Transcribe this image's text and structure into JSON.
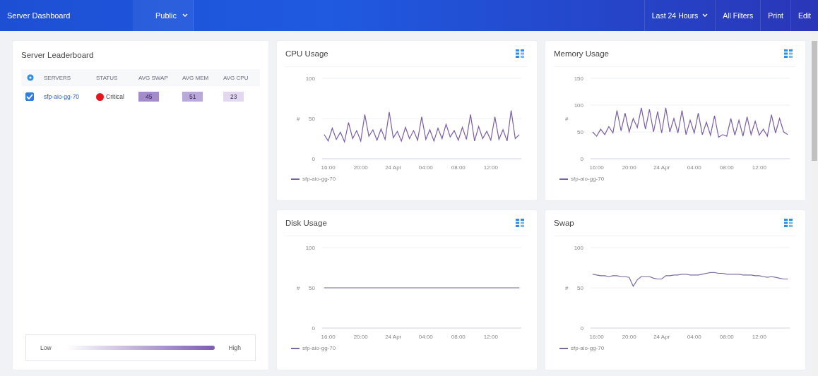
{
  "topbar": {
    "title": "Server Dashboard",
    "view": {
      "label": "Public",
      "dropdown": true
    },
    "actions": [
      {
        "label": "Last 24 Hours",
        "dropdown": true
      },
      {
        "label": "All Filters",
        "dropdown": false
      },
      {
        "label": "Print",
        "dropdown": false
      },
      {
        "label": "Edit",
        "dropdown": false
      }
    ]
  },
  "leaderboard": {
    "title": "Server Leaderboard",
    "columns": [
      "SERVERS",
      "STATUS",
      "AVG SWAP",
      "AVG MEM",
      "AVG CPU"
    ],
    "rows": [
      {
        "checked": true,
        "server": "sfp-aio-gg-70",
        "status": {
          "label": "Critical",
          "color": "#e8141b"
        },
        "metrics": [
          {
            "value": "45",
            "color": "#a48bcc"
          },
          {
            "value": "51",
            "color": "#bba8db"
          },
          {
            "value": "23",
            "color": "#e2d9f0"
          }
        ]
      }
    ],
    "legend": {
      "low": "Low",
      "high": "High"
    }
  },
  "charts": [
    {
      "title": "CPU Usage",
      "chart_data": {
        "type": "line",
        "ylabel": "#",
        "ylim": [
          0,
          100
        ],
        "yticks": [
          0,
          50,
          100
        ],
        "categories": [
          null,
          "16:00",
          null,
          null,
          null,
          null,
          null,
          null,
          null,
          "20:00",
          null,
          null,
          null,
          null,
          null,
          null,
          null,
          "24 Apr",
          null,
          null,
          null,
          null,
          null,
          null,
          null,
          "04:00",
          null,
          null,
          null,
          null,
          null,
          null,
          null,
          "08:00",
          null,
          null,
          null,
          null,
          null,
          null,
          null,
          "12:00",
          null,
          null,
          null,
          null,
          null,
          null,
          null
        ],
        "series": [
          {
            "name": "sfp-aio-gg-70",
            "color": "#7b5ea7",
            "values": [
              30,
              22,
              38,
              24,
              33,
              21,
              45,
              25,
              35,
              22,
              55,
              28,
              36,
              23,
              37,
              24,
              58,
              26,
              34,
              22,
              39,
              25,
              35,
              23,
              52,
              24,
              36,
              22,
              38,
              25,
              43,
              27,
              35,
              23,
              39,
              24,
              55,
              22,
              40,
              25,
              34,
              23,
              52,
              24,
              36,
              22,
              60,
              25,
              30
            ]
          }
        ]
      }
    },
    {
      "title": "Memory Usage",
      "chart_data": {
        "type": "line",
        "ylabel": "#",
        "ylim": [
          0,
          150
        ],
        "yticks": [
          0,
          50,
          100,
          150
        ],
        "categories": [
          null,
          "16:00",
          null,
          null,
          null,
          null,
          null,
          null,
          null,
          "20:00",
          null,
          null,
          null,
          null,
          null,
          null,
          null,
          "24 Apr",
          null,
          null,
          null,
          null,
          null,
          null,
          null,
          "04:00",
          null,
          null,
          null,
          null,
          null,
          null,
          null,
          "08:00",
          null,
          null,
          null,
          null,
          null,
          null,
          null,
          "12:00",
          null,
          null,
          null,
          null,
          null,
          null,
          null
        ],
        "series": [
          {
            "name": "sfp-aio-gg-70",
            "color": "#7b5ea7",
            "values": [
              50,
              42,
              55,
              45,
              60,
              48,
              90,
              52,
              85,
              50,
              75,
              58,
              95,
              55,
              92,
              50,
              88,
              48,
              95,
              50,
              75,
              48,
              90,
              45,
              72,
              48,
              85,
              45,
              68,
              44,
              80,
              40,
              45,
              42,
              75,
              44,
              72,
              42,
              78,
              45,
              70,
              44,
              55,
              42,
              82,
              48,
              75,
              50,
              45
            ]
          }
        ]
      }
    },
    {
      "title": "Disk Usage",
      "chart_data": {
        "type": "line",
        "ylabel": "#",
        "ylim": [
          0,
          100
        ],
        "yticks": [
          0,
          50,
          100
        ],
        "categories": [
          null,
          "16:00",
          null,
          null,
          null,
          null,
          null,
          null,
          null,
          "20:00",
          null,
          null,
          null,
          null,
          null,
          null,
          null,
          "24 Apr",
          null,
          null,
          null,
          null,
          null,
          null,
          null,
          "04:00",
          null,
          null,
          null,
          null,
          null,
          null,
          null,
          "08:00",
          null,
          null,
          null,
          null,
          null,
          null,
          null,
          "12:00",
          null,
          null,
          null,
          null,
          null,
          null,
          null
        ],
        "series": [
          {
            "name": "sfp-aio-gg-70",
            "color": "#7b6aa0",
            "values": [
              50,
              50,
              50,
              50,
              50,
              50,
              50,
              50,
              50,
              50,
              50,
              50,
              50,
              50,
              50,
              50,
              50,
              50,
              50,
              50,
              50,
              50,
              50,
              50,
              50,
              50,
              50,
              50,
              50,
              50,
              50,
              50,
              50,
              50,
              50,
              50,
              50,
              50,
              50,
              50,
              50,
              50,
              50,
              50,
              50,
              50,
              50,
              50,
              50
            ]
          }
        ]
      }
    },
    {
      "title": "Swap",
      "chart_data": {
        "type": "line",
        "ylabel": "#",
        "ylim": [
          0,
          100
        ],
        "yticks": [
          0,
          50,
          100
        ],
        "categories": [
          null,
          "16:00",
          null,
          null,
          null,
          null,
          null,
          null,
          null,
          "20:00",
          null,
          null,
          null,
          null,
          null,
          null,
          null,
          "24 Apr",
          null,
          null,
          null,
          null,
          null,
          null,
          null,
          "04:00",
          null,
          null,
          null,
          null,
          null,
          null,
          null,
          "08:00",
          null,
          null,
          null,
          null,
          null,
          null,
          null,
          "12:00",
          null,
          null,
          null,
          null,
          null,
          null,
          null
        ],
        "series": [
          {
            "name": "sfp-aio-gg-70",
            "color": "#7b6aa0",
            "values": [
              67,
              66,
              65,
              65,
              64,
              65,
              65,
              64,
              64,
              63,
              52,
              60,
              64,
              64,
              64,
              62,
              61,
              61,
              65,
              65,
              66,
              66,
              67,
              67,
              66,
              66,
              66,
              67,
              68,
              69,
              69,
              68,
              68,
              67,
              67,
              67,
              67,
              66,
              66,
              66,
              65,
              65,
              64,
              63,
              64,
              63,
              62,
              61,
              61
            ]
          }
        ]
      }
    }
  ]
}
